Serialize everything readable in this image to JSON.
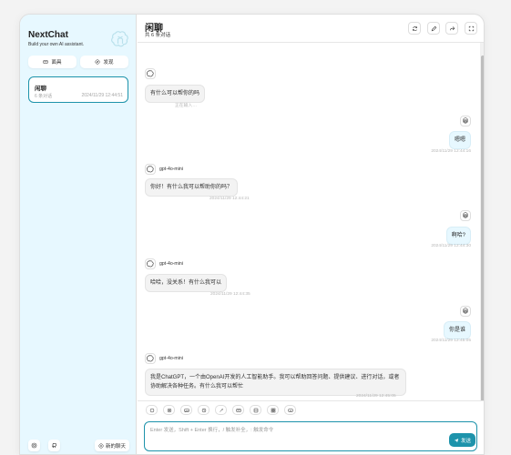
{
  "colors": {
    "accent": "#1d93ab",
    "sidebar_bg": "#e7f8ff",
    "user_bubble": "#e7f8ff",
    "bot_bubble": "#f3f3f3"
  },
  "sidebar": {
    "title": "NextChat",
    "subtitle": "Build your own AI assistant.",
    "mask_btn": "面具",
    "discover_btn": "发现",
    "chat_item": {
      "title": "闲聊",
      "count": "6 条对话",
      "time": "2024/11/29 12:44:51"
    },
    "new_chat": "新的聊天"
  },
  "header": {
    "title": "闲聊",
    "subtitle": "共 6 条对话"
  },
  "messages": [
    {
      "role": "bot",
      "model": "",
      "text": "有什么可以帮你的吗",
      "time": "正在输入…"
    },
    {
      "role": "user",
      "text": "嗯嗯",
      "time": "2024/11/29 12:44:16"
    },
    {
      "role": "bot",
      "model": "gpt-4o-mini",
      "text": "你好！有什么我可以帮助你的吗？",
      "time": "2024/11/29 12:44:21"
    },
    {
      "role": "user",
      "text": "啊哈?",
      "time": "2024/11/29 12:44:30"
    },
    {
      "role": "bot",
      "model": "gpt-4o-mini",
      "text": "哈哈，没关系！有什么我可以",
      "time": "2024/11/29 12:44:35"
    },
    {
      "role": "user",
      "text": "你是谁",
      "time": "2024/11/29 12:45:05"
    },
    {
      "role": "bot",
      "model": "gpt-4o-mini",
      "text_line1": "我是ChatGPT，一个由OpenAI开发的人工智能助手。我可以帮助回答问题、提供建议、进行对话，或者",
      "text_line2": "协助解决各种任务。有什么我可以帮忙",
      "time": "2024/11/29 12:45:05"
    }
  ],
  "input": {
    "placeholder": "Enter 发送，Shift + Enter 换行，/ 触发补全，: 触发命令",
    "send_label": "发送"
  },
  "user_avatar": "😀",
  "icons": [
    "openai-logo-icon",
    "mask-icon",
    "discover-icon",
    "settings-icon",
    "github-icon",
    "plus-icon",
    "reload-icon",
    "edit-icon",
    "share-icon",
    "fullscreen-icon",
    "send-icon"
  ]
}
